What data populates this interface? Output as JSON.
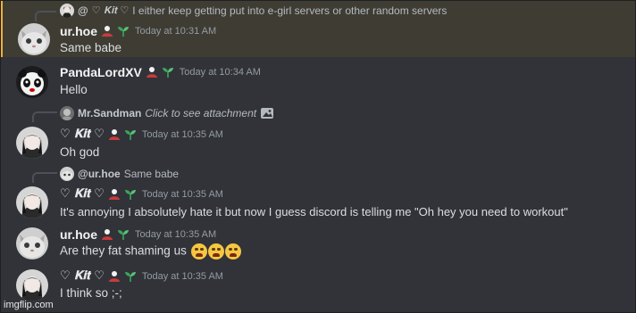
{
  "reply0": {
    "prefix": "@",
    "name": "♡ 𝐊𝐢𝐭 ♡",
    "text": "I either keep getting put into e-girl servers or other random servers"
  },
  "messages": [
    {
      "username": "ur.hoe",
      "time": "Today at 10:31 AM",
      "text": "Same babe"
    },
    {
      "username": "PandaLordXV",
      "time": "Today at 10:34 AM",
      "text": "Hello"
    },
    {
      "reply_name": "Mr.Sandman",
      "reply_text": "Click to see attachment",
      "username": "♡ 𝐊𝐢𝐭 ♡",
      "time": "Today at 10:35 AM",
      "text": "Oh god"
    },
    {
      "reply_name": "@ur.hoe",
      "reply_text": "Same babe",
      "username": "♡ 𝐊𝐢𝐭 ♡",
      "time": "Today at 10:35 AM",
      "text": "It's annoying I absolutely hate it but now I guess discord is telling me \"Oh hey you need to workout\""
    },
    {
      "username": "ur.hoe",
      "time": "Today at 10:35 AM",
      "text": "Are they fat shaming us"
    },
    {
      "username": "♡ 𝐊𝐢𝐭 ♡",
      "time": "Today at 10:35 AM",
      "text": "I think so ;-;"
    }
  ],
  "watermark": "imgflip.com",
  "colors": {
    "background": "#313338",
    "highlight": "#3f3d33",
    "highlight_border": "#f0b232",
    "badge_green": "#3ba55d",
    "badge_red": "#c83b3b"
  },
  "icons": {
    "role_badge": "person-silhouette-icon",
    "sprout_badge": "sprout-icon",
    "attachment": "image-icon",
    "emoji": "loudly-crying-face-emoji"
  }
}
